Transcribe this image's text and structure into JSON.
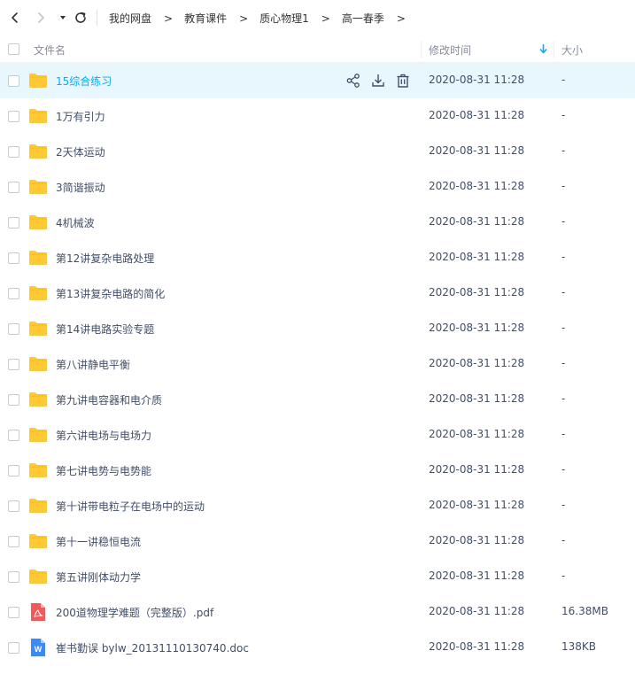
{
  "nav": {
    "back_icon": "chevron-left-icon",
    "forward_icon": "chevron-right-icon",
    "dropdown_icon": "caret-down-icon",
    "refresh_icon": "refresh-icon"
  },
  "breadcrumb": [
    "我的网盘",
    "教育课件",
    "质心物理1",
    "高一春季"
  ],
  "breadcrumb_separator": ">",
  "columns": {
    "name": "文件名",
    "modified": "修改时间",
    "size": "大小",
    "sort_icon": "sort-down-arrow-icon"
  },
  "colors": {
    "accent": "#09aaff",
    "selected_row": "#e8f6fd",
    "folder": "#ffc933",
    "pdf": "#f25a5a",
    "doc": "#3d8af7"
  },
  "row_actions": [
    "share-icon",
    "download-icon",
    "delete-icon"
  ],
  "files": [
    {
      "name": "15综合练习",
      "type": "folder",
      "modified": "2020-08-31 11:28",
      "size": "-",
      "selected": true
    },
    {
      "name": "1万有引力",
      "type": "folder",
      "modified": "2020-08-31 11:28",
      "size": "-"
    },
    {
      "name": "2天体运动",
      "type": "folder",
      "modified": "2020-08-31 11:28",
      "size": "-"
    },
    {
      "name": "3简谐振动",
      "type": "folder",
      "modified": "2020-08-31 11:28",
      "size": "-"
    },
    {
      "name": "4机械波",
      "type": "folder",
      "modified": "2020-08-31 11:28",
      "size": "-"
    },
    {
      "name": "第12讲复杂电路处理",
      "type": "folder",
      "modified": "2020-08-31 11:28",
      "size": "-"
    },
    {
      "name": "第13讲复杂电路的简化",
      "type": "folder",
      "modified": "2020-08-31 11:28",
      "size": "-"
    },
    {
      "name": "第14讲电路实验专题",
      "type": "folder",
      "modified": "2020-08-31 11:28",
      "size": "-"
    },
    {
      "name": "第八讲静电平衡",
      "type": "folder",
      "modified": "2020-08-31 11:28",
      "size": "-"
    },
    {
      "name": "第九讲电容器和电介质",
      "type": "folder",
      "modified": "2020-08-31 11:28",
      "size": "-"
    },
    {
      "name": "第六讲电场与电场力",
      "type": "folder",
      "modified": "2020-08-31 11:28",
      "size": "-"
    },
    {
      "name": "第七讲电势与电势能",
      "type": "folder",
      "modified": "2020-08-31 11:28",
      "size": "-"
    },
    {
      "name": "第十讲带电粒子在电场中的运动",
      "type": "folder",
      "modified": "2020-08-31 11:28",
      "size": "-"
    },
    {
      "name": "第十一讲稳恒电流",
      "type": "folder",
      "modified": "2020-08-31 11:28",
      "size": "-"
    },
    {
      "name": "第五讲刚体动力学",
      "type": "folder",
      "modified": "2020-08-31 11:28",
      "size": "-"
    },
    {
      "name": "200道物理学难题（完整版）.pdf",
      "type": "pdf",
      "modified": "2020-08-31 11:28",
      "size": "16.38MB"
    },
    {
      "name": "崔书勤误 bylw_20131110130740.doc",
      "type": "doc",
      "modified": "2020-08-31 11:28",
      "size": "138KB"
    }
  ]
}
